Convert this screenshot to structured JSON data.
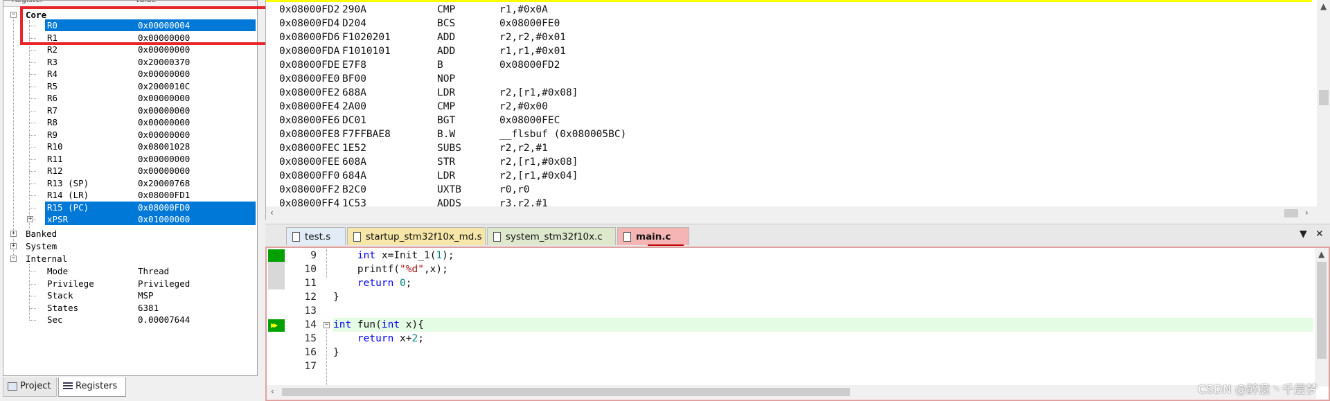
{
  "registers": {
    "header": {
      "col_register": "Register",
      "col_value": "Value"
    },
    "groups": {
      "core": "Core",
      "banked": "Banked",
      "system": "System",
      "internal": "Internal"
    },
    "core_rows": [
      {
        "name": "R0",
        "value": "0x00000004",
        "selected": true
      },
      {
        "name": "R1",
        "value": "0x00000000",
        "selected": false
      },
      {
        "name": "R2",
        "value": "0x00000000",
        "selected": false
      },
      {
        "name": "R3",
        "value": "0x20000370",
        "selected": false
      },
      {
        "name": "R4",
        "value": "0x00000000",
        "selected": false
      },
      {
        "name": "R5",
        "value": "0x2000010C",
        "selected": false
      },
      {
        "name": "R6",
        "value": "0x00000000",
        "selected": false
      },
      {
        "name": "R7",
        "value": "0x00000000",
        "selected": false
      },
      {
        "name": "R8",
        "value": "0x00000000",
        "selected": false
      },
      {
        "name": "R9",
        "value": "0x00000000",
        "selected": false
      },
      {
        "name": "R10",
        "value": "0x08001028",
        "selected": false
      },
      {
        "name": "R11",
        "value": "0x00000000",
        "selected": false
      },
      {
        "name": "R12",
        "value": "0x00000000",
        "selected": false
      },
      {
        "name": "R13 (SP)",
        "value": "0x20000768",
        "selected": false
      },
      {
        "name": "R14 (LR)",
        "value": "0x08000FD1",
        "selected": false
      },
      {
        "name": "R15 (PC)",
        "value": "0x08000FD0",
        "selected": true
      },
      {
        "name": "xPSR",
        "value": "0x01000000",
        "selected": true
      }
    ],
    "internal_rows": [
      {
        "name": "Mode",
        "value": "Thread"
      },
      {
        "name": "Privilege",
        "value": "Privileged"
      },
      {
        "name": "Stack",
        "value": "MSP"
      },
      {
        "name": "States",
        "value": "6381"
      },
      {
        "name": "Sec",
        "value": "0.00007644"
      }
    ]
  },
  "left_tabs": {
    "project": "Project",
    "registers": "Registers"
  },
  "disassembly": [
    {
      "addr": "0x08000FD2",
      "code": "290A",
      "mnem": "CMP",
      "ops": "r1,#0x0A"
    },
    {
      "addr": "0x08000FD4",
      "code": "D204",
      "mnem": "BCS",
      "ops": "0x08000FE0"
    },
    {
      "addr": "0x08000FD6",
      "code": "F1020201",
      "mnem": "ADD",
      "ops": "r2,r2,#0x01"
    },
    {
      "addr": "0x08000FDA",
      "code": "F1010101",
      "mnem": "ADD",
      "ops": "r1,r1,#0x01"
    },
    {
      "addr": "0x08000FDE",
      "code": "E7F8",
      "mnem": "B",
      "ops": "0x08000FD2"
    },
    {
      "addr": "0x08000FE0",
      "code": "BF00",
      "mnem": "NOP",
      "ops": ""
    },
    {
      "addr": "0x08000FE2",
      "code": "688A",
      "mnem": "LDR",
      "ops": "r2,[r1,#0x08]"
    },
    {
      "addr": "0x08000FE4",
      "code": "2A00",
      "mnem": "CMP",
      "ops": "r2,#0x00"
    },
    {
      "addr": "0x08000FE6",
      "code": "DC01",
      "mnem": "BGT",
      "ops": "0x08000FEC"
    },
    {
      "addr": "0x08000FE8",
      "code": "F7FFBAE8",
      "mnem": "B.W",
      "ops": "__flsbuf (0x080005BC)"
    },
    {
      "addr": "0x08000FEC",
      "code": "1E52",
      "mnem": "SUBS",
      "ops": "r2,r2,#1"
    },
    {
      "addr": "0x08000FEE",
      "code": "608A",
      "mnem": "STR",
      "ops": "r2,[r1,#0x08]"
    },
    {
      "addr": "0x08000FF0",
      "code": "684A",
      "mnem": "LDR",
      "ops": "r2,[r1,#0x04]"
    },
    {
      "addr": "0x08000FF2",
      "code": "B2C0",
      "mnem": "UXTB",
      "ops": "r0,r0"
    },
    {
      "addr": "0x08000FF4",
      "code": "1C53",
      "mnem": "ADDS",
      "ops": "r3,r2,#1"
    }
  ],
  "editor_tabs": [
    {
      "label": "test.s",
      "color": "#e1ecf7"
    },
    {
      "label": "startup_stm32f10x_md.s",
      "color": "#f6e7a8"
    },
    {
      "label": "system_stm32f10x.c",
      "color": "#dde8cc"
    },
    {
      "label": "main.c",
      "color": "#f5b5b5",
      "active": true
    }
  ],
  "code_lines": [
    {
      "num": "9"
    },
    {
      "num": "10"
    },
    {
      "num": "11"
    },
    {
      "num": "12",
      "text": "}"
    },
    {
      "num": "13",
      "text": ""
    },
    {
      "num": "14"
    },
    {
      "num": "15"
    },
    {
      "num": "16",
      "text": "}"
    },
    {
      "num": "17",
      "text": ""
    }
  ],
  "code_tokens": {
    "l9a": "int",
    "l9b": " x=Init_1(",
    "l9c": "1",
    "l9d": ");",
    "l10a": "printf(",
    "l10b": "\"%d\"",
    "l10c": ",x);",
    "l11a": "return",
    "l11b": " ",
    "l11c": "0",
    "l11d": ";",
    "l14a": "int",
    "l14b": " fun(",
    "l14c": "int",
    "l14d": " x){",
    "l15a": "return",
    "l15b": " x+",
    "l15c": "2",
    "l15d": ";"
  },
  "watermark": "CSDN @醉意丶千层梦",
  "colors": {
    "selection": "#0078d7",
    "annotation": "#e8252b",
    "current_line": "#e4fbe4",
    "gutter_marker": "#00a000"
  }
}
